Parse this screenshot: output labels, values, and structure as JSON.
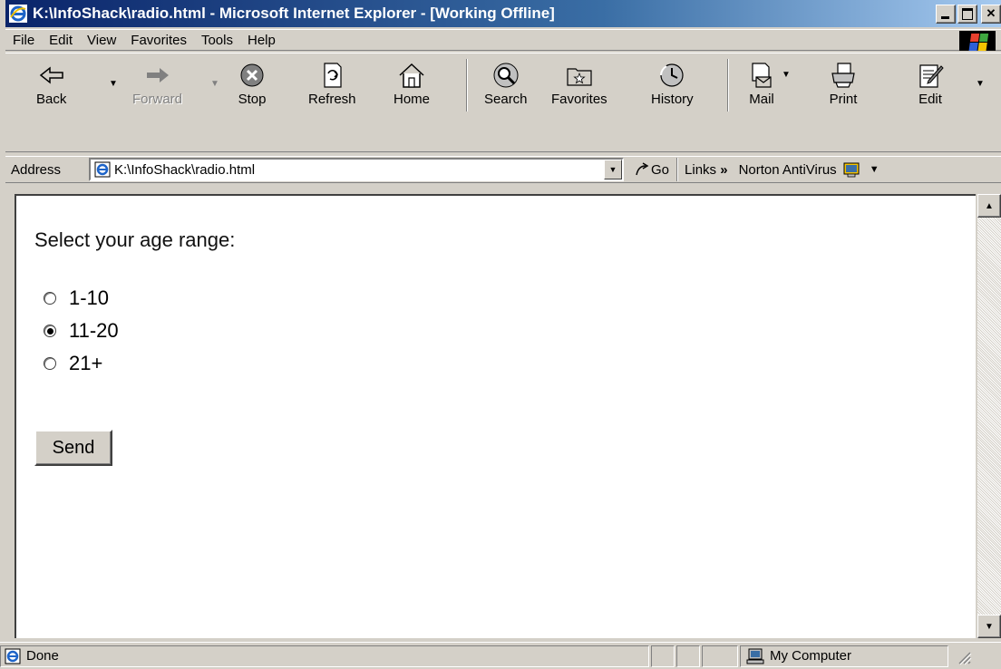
{
  "window": {
    "title": "K:\\InfoShack\\radio.html - Microsoft Internet Explorer - [Working Offline]"
  },
  "menu": {
    "items": [
      {
        "label": "File",
        "key": "F"
      },
      {
        "label": "Edit",
        "key": "E"
      },
      {
        "label": "View",
        "key": "V"
      },
      {
        "label": "Favorites",
        "key": "a"
      },
      {
        "label": "Tools",
        "key": "T"
      },
      {
        "label": "Help",
        "key": "H"
      }
    ]
  },
  "toolbar": {
    "back": "Back",
    "forward": "Forward",
    "stop": "Stop",
    "refresh": "Refresh",
    "home": "Home",
    "search": "Search",
    "favorites": "Favorites",
    "history": "History",
    "mail": "Mail",
    "print": "Print",
    "edit": "Edit"
  },
  "address": {
    "label": "Address",
    "value": "K:\\InfoShack\\radio.html",
    "go": "Go"
  },
  "links": {
    "label": "Links",
    "norton": "Norton AntiVirus"
  },
  "page": {
    "prompt": "Select your age range:",
    "options": [
      {
        "label": "1-10",
        "checked": false
      },
      {
        "label": "11-20",
        "checked": true
      },
      {
        "label": "21+",
        "checked": false
      }
    ],
    "send": "Send"
  },
  "status": {
    "text": "Done",
    "zone": "My Computer"
  }
}
